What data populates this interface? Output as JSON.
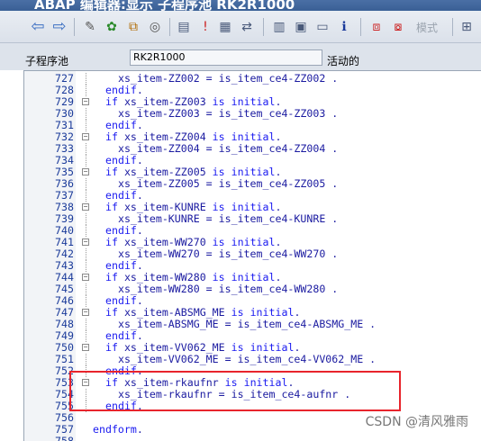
{
  "window": {
    "title": "ABAP 编辑器:显示 子程序池 RK2R1000"
  },
  "toolbar": {
    "mode_label": "模式",
    "icons": [
      "back-arrow-icon",
      "forward-arrow-icon",
      "check-syntax-icon",
      "other-object-icon",
      "activate-icon",
      "where-used-icon",
      "display-object-list-icon",
      "info-icon",
      "insert-statement-icon",
      "pattern-icon",
      "hierarchy-icon",
      "display-change-icon",
      "help-icon",
      "breakpoint-icon",
      "external-breakpoint-icon",
      "more-icon"
    ]
  },
  "field": {
    "label": "子程序池",
    "value": "RK2R1000",
    "status": "活动的"
  },
  "code": [
    {
      "n": "727",
      "text": "  xs_item-ZZ002 = is_item_ce4-ZZ002 .",
      "fold": false
    },
    {
      "n": "728",
      "text": "endif.",
      "fold": false
    },
    {
      "n": "729",
      "text": "if xs_item-ZZ003 is initial.",
      "fold": true
    },
    {
      "n": "730",
      "text": "  xs_item-ZZ003 = is_item_ce4-ZZ003 .",
      "fold": false
    },
    {
      "n": "731",
      "text": "endif.",
      "fold": false
    },
    {
      "n": "732",
      "text": "if xs_item-ZZ004 is initial.",
      "fold": true
    },
    {
      "n": "733",
      "text": "  xs_item-ZZ004 = is_item_ce4-ZZ004 .",
      "fold": false
    },
    {
      "n": "734",
      "text": "endif.",
      "fold": false
    },
    {
      "n": "735",
      "text": "if xs_item-ZZ005 is initial.",
      "fold": true
    },
    {
      "n": "736",
      "text": "  xs_item-ZZ005 = is_item_ce4-ZZ005 .",
      "fold": false
    },
    {
      "n": "737",
      "text": "endif.",
      "fold": false
    },
    {
      "n": "738",
      "text": "if xs_item-KUNRE is initial.",
      "fold": true
    },
    {
      "n": "739",
      "text": "  xs_item-KUNRE = is_item_ce4-KUNRE .",
      "fold": false
    },
    {
      "n": "740",
      "text": "endif.",
      "fold": false
    },
    {
      "n": "741",
      "text": "if xs_item-WW270 is initial.",
      "fold": true
    },
    {
      "n": "742",
      "text": "  xs_item-WW270 = is_item_ce4-WW270 .",
      "fold": false
    },
    {
      "n": "743",
      "text": "endif.",
      "fold": false
    },
    {
      "n": "744",
      "text": "if xs_item-WW280 is initial.",
      "fold": true
    },
    {
      "n": "745",
      "text": "  xs_item-WW280 = is_item_ce4-WW280 .",
      "fold": false
    },
    {
      "n": "746",
      "text": "endif.",
      "fold": false
    },
    {
      "n": "747",
      "text": "if xs_item-ABSMG_ME is initial.",
      "fold": true
    },
    {
      "n": "748",
      "text": "  xs_item-ABSMG_ME = is_item_ce4-ABSMG_ME .",
      "fold": false
    },
    {
      "n": "749",
      "text": "endif.",
      "fold": false
    },
    {
      "n": "750",
      "text": "if xs_item-VV062_ME is initial.",
      "fold": true
    },
    {
      "n": "751",
      "text": "  xs_item-VV062_ME = is_item_ce4-VV062_ME .",
      "fold": false
    },
    {
      "n": "752",
      "text": "endif.",
      "fold": false
    },
    {
      "n": "753",
      "text": "if xs_item-rkaufnr is initial.",
      "fold": true
    },
    {
      "n": "754",
      "text": "  xs_item-rkaufnr = is_item_ce4-aufnr .",
      "fold": false
    },
    {
      "n": "755",
      "text": "endif.",
      "fold": false
    },
    {
      "n": "756",
      "text": "",
      "fold": false
    },
    {
      "n": "757",
      "text": "endform.",
      "fold": false,
      "outer": true
    },
    {
      "n": "758",
      "text": "",
      "fold": false
    }
  ],
  "watermark": "CSDN @清风雅雨"
}
